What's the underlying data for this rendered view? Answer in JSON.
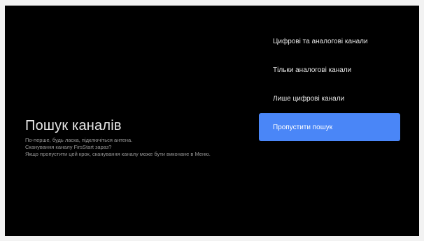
{
  "screen": {
    "title": "Пошук каналів",
    "description": [
      "По-перше, будь ласка, підключіться антена.",
      "Сканування каналу FirsStart зараз?",
      "Якщо пропустити цей крок, сканування каналу може бути виконане в Меню."
    ]
  },
  "menu": {
    "items": [
      {
        "label": "Цифрові та аналогові канали",
        "selected": false
      },
      {
        "label": "Тільки аналогові канали",
        "selected": false
      },
      {
        "label": "Лише цифрові канали",
        "selected": false
      },
      {
        "label": "Пропустити пошук",
        "selected": true
      }
    ]
  },
  "colors": {
    "background": "#000000",
    "accent": "#4a86f7",
    "text_primary": "#e8e8e8",
    "text_secondary": "#9a9a9a"
  }
}
